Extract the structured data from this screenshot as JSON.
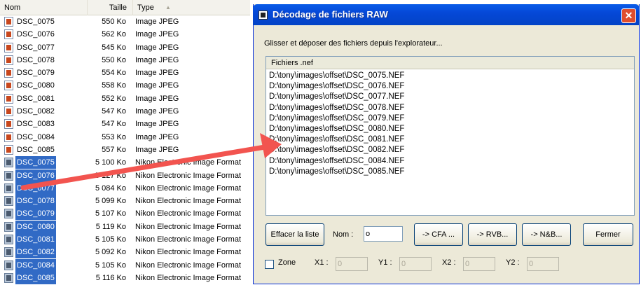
{
  "explorer": {
    "columns": {
      "name": "Nom",
      "size": "Taille",
      "type": "Type"
    },
    "rows": [
      {
        "name": "DSC_0075",
        "size": "550 Ko",
        "type": "Image JPEG",
        "kind": "jpeg",
        "selected": false
      },
      {
        "name": "DSC_0076",
        "size": "562 Ko",
        "type": "Image JPEG",
        "kind": "jpeg",
        "selected": false
      },
      {
        "name": "DSC_0077",
        "size": "545 Ko",
        "type": "Image JPEG",
        "kind": "jpeg",
        "selected": false
      },
      {
        "name": "DSC_0078",
        "size": "550 Ko",
        "type": "Image JPEG",
        "kind": "jpeg",
        "selected": false
      },
      {
        "name": "DSC_0079",
        "size": "554 Ko",
        "type": "Image JPEG",
        "kind": "jpeg",
        "selected": false
      },
      {
        "name": "DSC_0080",
        "size": "558 Ko",
        "type": "Image JPEG",
        "kind": "jpeg",
        "selected": false
      },
      {
        "name": "DSC_0081",
        "size": "552 Ko",
        "type": "Image JPEG",
        "kind": "jpeg",
        "selected": false
      },
      {
        "name": "DSC_0082",
        "size": "547 Ko",
        "type": "Image JPEG",
        "kind": "jpeg",
        "selected": false
      },
      {
        "name": "DSC_0083",
        "size": "547 Ko",
        "type": "Image JPEG",
        "kind": "jpeg",
        "selected": false
      },
      {
        "name": "DSC_0084",
        "size": "553 Ko",
        "type": "Image JPEG",
        "kind": "jpeg",
        "selected": false
      },
      {
        "name": "DSC_0085",
        "size": "557 Ko",
        "type": "Image JPEG",
        "kind": "jpeg",
        "selected": false
      },
      {
        "name": "DSC_0075",
        "size": "5 100 Ko",
        "type": "Nikon Electronic Image Format",
        "kind": "nef",
        "selected": true
      },
      {
        "name": "DSC_0076",
        "size": "5 127 Ko",
        "type": "Nikon Electronic Image Format",
        "kind": "nef",
        "selected": true
      },
      {
        "name": "DSC_0077",
        "size": "5 084 Ko",
        "type": "Nikon Electronic Image Format",
        "kind": "nef",
        "selected": true
      },
      {
        "name": "DSC_0078",
        "size": "5 099 Ko",
        "type": "Nikon Electronic Image Format",
        "kind": "nef",
        "selected": true
      },
      {
        "name": "DSC_0079",
        "size": "5 107 Ko",
        "type": "Nikon Electronic Image Format",
        "kind": "nef",
        "selected": true
      },
      {
        "name": "DSC_0080",
        "size": "5 119 Ko",
        "type": "Nikon Electronic Image Format",
        "kind": "nef",
        "selected": true
      },
      {
        "name": "DSC_0081",
        "size": "5 105 Ko",
        "type": "Nikon Electronic Image Format",
        "kind": "nef",
        "selected": true
      },
      {
        "name": "DSC_0082",
        "size": "5 092 Ko",
        "type": "Nikon Electronic Image Format",
        "kind": "nef",
        "selected": true
      },
      {
        "name": "DSC_0084",
        "size": "5 105 Ko",
        "type": "Nikon Electronic Image Format",
        "kind": "nef",
        "selected": true
      },
      {
        "name": "DSC_0085",
        "size": "5 116 Ko",
        "type": "Nikon Electronic Image Format",
        "kind": "nef",
        "selected": true
      }
    ]
  },
  "dialog": {
    "title": "Décodage de fichiers RAW",
    "close": "✕",
    "hint": "Glisser et déposer des fichiers depuis l'explorateur...",
    "list_header": "Fichiers .nef",
    "files": [
      "D:\\tony\\images\\offset\\DSC_0075.NEF",
      "D:\\tony\\images\\offset\\DSC_0076.NEF",
      "D:\\tony\\images\\offset\\DSC_0077.NEF",
      "D:\\tony\\images\\offset\\DSC_0078.NEF",
      "D:\\tony\\images\\offset\\DSC_0079.NEF",
      "D:\\tony\\images\\offset\\DSC_0080.NEF",
      "D:\\tony\\images\\offset\\DSC_0081.NEF",
      "D:\\tony\\images\\offset\\DSC_0082.NEF",
      "D:\\tony\\images\\offset\\DSC_0084.NEF",
      "D:\\tony\\images\\offset\\DSC_0085.NEF"
    ],
    "buttons": {
      "clear": "Effacer la liste",
      "cfa": "-> CFA ...",
      "rvb": "-> RVB...",
      "nb": "-> N&B...",
      "close": "Fermer"
    },
    "name_label": "Nom :",
    "name_value": "o",
    "zone_label": "Zone",
    "coords": {
      "x1": "X1 :",
      "y1": "Y1 :",
      "x2": "X2 :",
      "y2": "Y2 :"
    },
    "coord_values": {
      "x1": "0",
      "y1": "0",
      "x2": "0",
      "y2": "0"
    }
  },
  "colors": {
    "selection": "#316ac5",
    "arrow": "#f2544f",
    "titlebar": "#0548d8",
    "close": "#e04e2c"
  },
  "icons": [
    "jpeg-file-icon",
    "nef-file-icon",
    "sort-ascending-icon",
    "app-icon",
    "close-icon",
    "drag-arrow-icon"
  ]
}
